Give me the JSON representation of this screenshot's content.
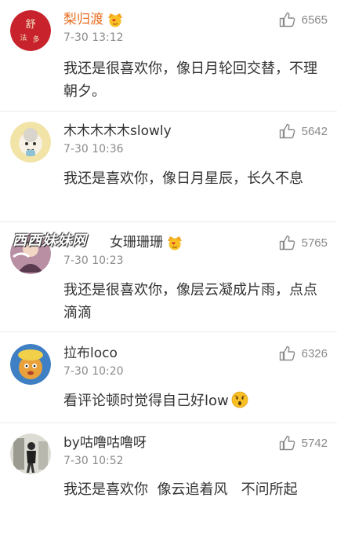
{
  "comments": [
    {
      "user": "梨归渡",
      "vip": true,
      "time": "7-30 13:12",
      "likes": "6565",
      "text": "我还是很喜欢你，像日月轮回交替，不理朝夕。",
      "avatar_text": "舒法多"
    },
    {
      "user": "木木木木木slowly",
      "vip": false,
      "time": "7-30 10:36",
      "likes": "5642",
      "text": "我还是喜欢你，像日月星辰，长久不息"
    },
    {
      "user": "女珊珊珊",
      "vip": true,
      "time": "7-30 10:23",
      "likes": "5765",
      "text": "我还是很喜欢你，像层云凝成片雨，点点滴滴"
    },
    {
      "user": "拉布loco",
      "vip": false,
      "time": "7-30 10:20",
      "likes": "6326",
      "text": "看评论顿时觉得自己好low",
      "emoji": "shocked-face-emoji"
    },
    {
      "user": "by咕噜咕噜呀",
      "vip": false,
      "time": "7-30 10:52",
      "likes": "5742",
      "text": "我还是喜欢你  像云追着风   不问所起"
    }
  ],
  "watermark": "西西妹妹网",
  "icons": {
    "like": "thumbs-up-icon",
    "vip": "vip-badge-icon"
  },
  "colors": {
    "vip_name": "#e86d22",
    "meta": "#8a8a8a",
    "text": "#333333"
  }
}
